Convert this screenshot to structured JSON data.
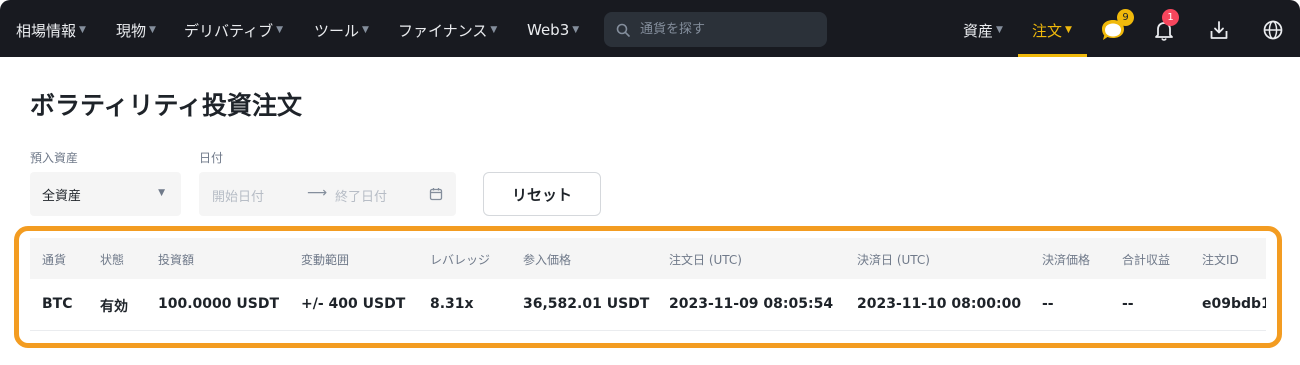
{
  "nav": {
    "items": [
      "相場情報",
      "現物",
      "デリバティブ",
      "ツール",
      "ファイナンス",
      "Web3"
    ],
    "search_placeholder": "通貨を探す",
    "assets_label": "資産",
    "orders_label": "注文",
    "messages_badge": "9",
    "notifications_badge": "1"
  },
  "page": {
    "title": "ボラティリティ投資注文"
  },
  "filters": {
    "deposit_label": "預入資産",
    "deposit_value": "全資産",
    "date_label": "日付",
    "start_placeholder": "開始日付",
    "end_placeholder": "終了日付",
    "reset_label": "リセット"
  },
  "table": {
    "headers": [
      "通貨",
      "状態",
      "投資額",
      "変動範囲",
      "レバレッジ",
      "参入価格",
      "注文日 (UTC)",
      "決済日 (UTC)",
      "決済価格",
      "合計収益",
      "注文ID"
    ],
    "rows": [
      [
        "BTC",
        "有効",
        "100.0000 USDT",
        "+/- 400 USDT",
        "8.31x",
        "36,582.01 USDT",
        "2023-11-09 08:05:54",
        "2023-11-10 08:00:00",
        "--",
        "--",
        "e09bdb1"
      ]
    ]
  },
  "colors": {
    "nav_bg": "#181a20",
    "accent": "#f0b90b",
    "highlight_border": "#f39c21",
    "badge_red": "#f6465d"
  }
}
